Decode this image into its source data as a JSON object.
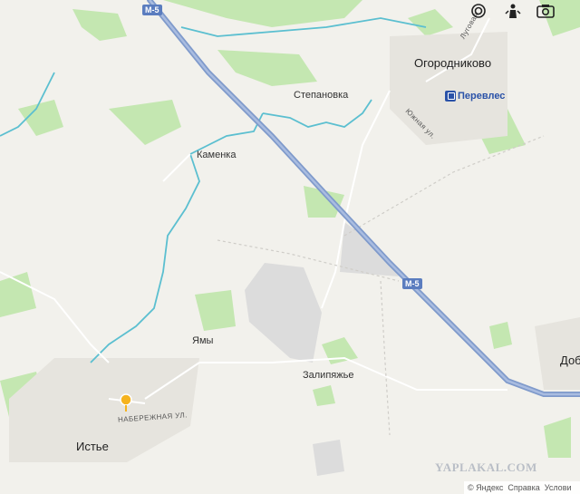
{
  "map": {
    "places": {
      "ogorodnikovo": "Огородниково",
      "stepanovka": "Степановка",
      "kamenka": "Каменка",
      "yamy": "Ямы",
      "zalipyazhye": "Залипяжье",
      "istye": "Истье",
      "dobr": "Добр"
    },
    "streets": {
      "luchevaya": "Луговая",
      "yuzhnaya": "Южная ул.",
      "naberezhnaya": "НАБЕРЕЖНАЯ УЛ."
    },
    "route_shields": [
      "М-5",
      "М-5"
    ],
    "poi": {
      "pereveles": "Перевлес"
    },
    "colors": {
      "background": "#f2f1ec",
      "forest": "#b7e0a6",
      "water": "#4cb8c9",
      "highway": "#8aa3cf",
      "industrial": "#dedede",
      "marker": "#f5b31f"
    }
  },
  "controls": {
    "traffic_icon": "layers-drop-icon",
    "people_icon": "people-icon",
    "camera_icon": "camera-icon"
  },
  "watermark": "YAPLAKAL.COM",
  "footer": {
    "brand": "© Яндекс",
    "help": "Справка",
    "terms": "Услови"
  }
}
